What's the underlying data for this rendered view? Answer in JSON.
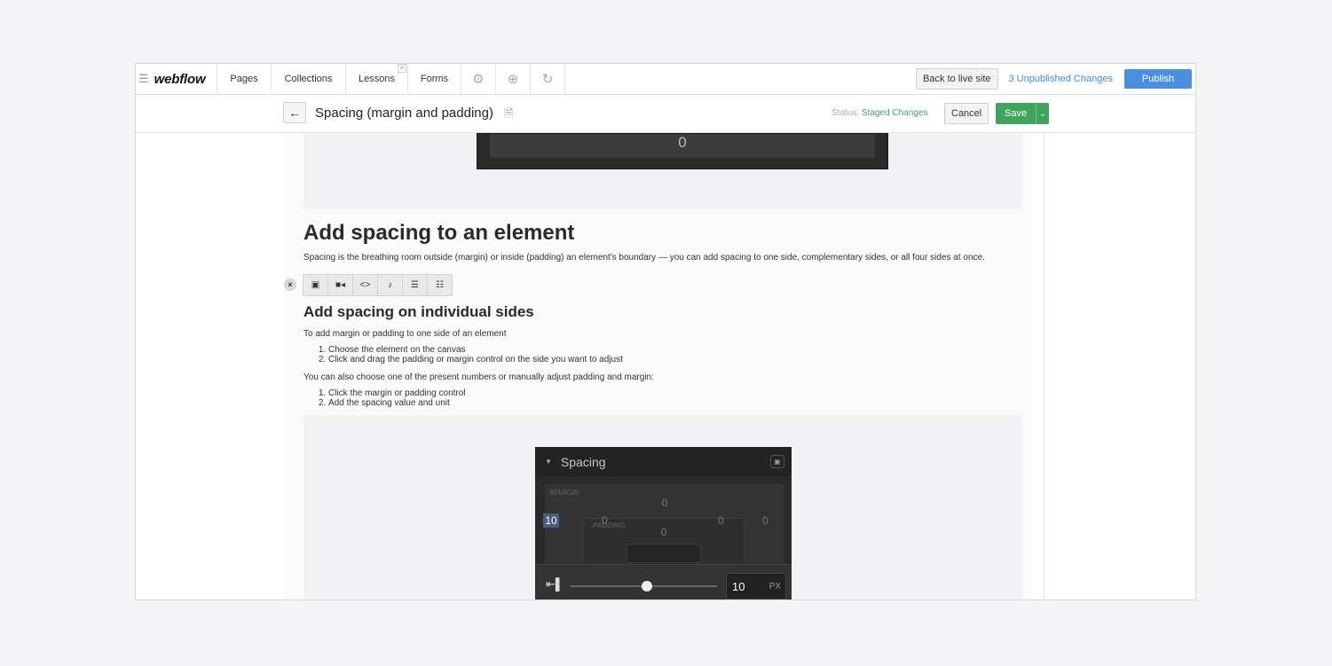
{
  "topbar": {
    "menu_icon": "hamburger-icon",
    "logo": "webflow",
    "tabs": [
      "Pages",
      "Collections",
      "Lessons",
      "Forms"
    ],
    "active_tab": "Lessons",
    "icon_tabs": [
      "gear-icon",
      "help-icon",
      "integrations-icon"
    ],
    "back_to_live_label": "Back to live site",
    "unpublished_label": "3 Unpublished Changes",
    "publish_label": "Publish",
    "accent": "#4a90e2"
  },
  "editbar": {
    "back_icon": "arrow-left-icon",
    "page_title": "Spacing (margin and padding)",
    "status_prefix": "Status: ",
    "status_value": "Staged Changes",
    "cancel_label": "Cancel",
    "save_label": "Save",
    "save_color": "#3fa55c"
  },
  "content": {
    "figure1_value": "0",
    "heading1": "Add spacing to an element",
    "paragraph1": "Spacing is the breathing room outside (margin) or inside (padding) an element's boundary — you can add spacing to one side, complementary sides, or all four sides at once.",
    "toolbar_icons": [
      "image-icon",
      "video-icon",
      "code-icon",
      "audio-icon",
      "bulleted-list-icon",
      "numbered-list-icon"
    ],
    "heading2": "Add spacing on individual sides",
    "intro1": "To add margin or padding to one side of an element",
    "steps1": [
      "Choose the element on the canvas",
      "Click and drag the padding or margin control on the side you want to adjust"
    ],
    "intro2": "You can also choose one of the present numbers or manually adjust padding and margin:",
    "steps2": [
      "Click the margin or padding control",
      "Add the spacing value and unit"
    ]
  },
  "spacing_panel": {
    "title": "Spacing",
    "margin_label": "MARGIN",
    "padding_label": "PADDING",
    "margin_top": "0",
    "padding_top": "0",
    "margin_left": "10",
    "padding_left": "0",
    "padding_right": "0",
    "margin_right": "0",
    "slider_value": "10",
    "slider_unit": "PX",
    "slider_fraction": 0.52
  }
}
